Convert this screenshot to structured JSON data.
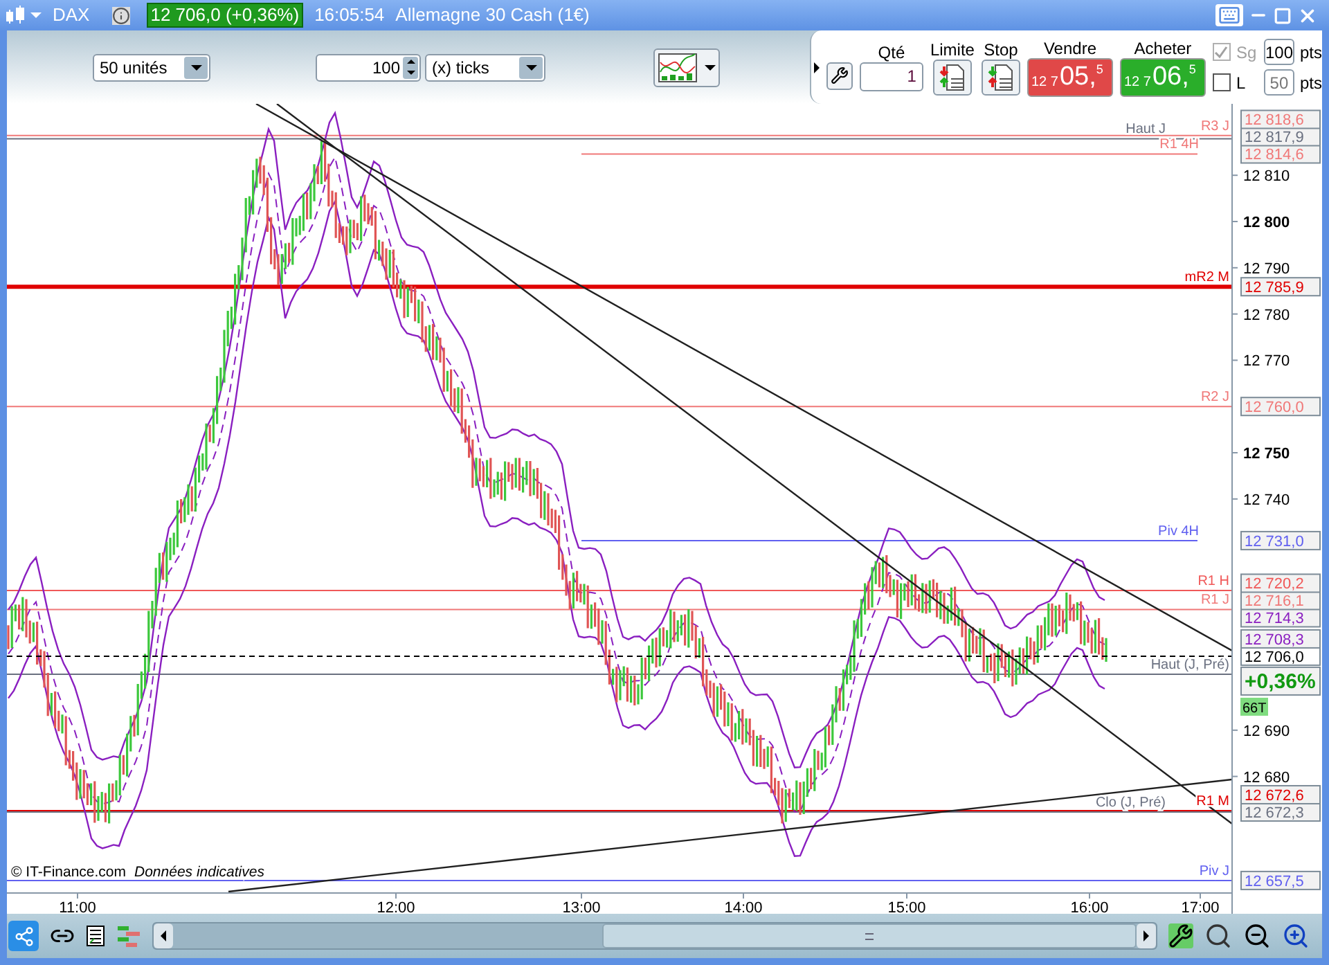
{
  "title_bar": {
    "symbol": "DAX",
    "quote": "12 706,0 (+0,36%)",
    "time": "16:05:54",
    "instrument": "Allemagne 30 Cash (1€)"
  },
  "toolbar": {
    "period": "50 unités",
    "tick_count": "100",
    "tick_unit": "(x) ticks"
  },
  "order_panel": {
    "qty_label": "Qté",
    "qty": "1",
    "limit_label": "Limite",
    "stop_label": "Stop",
    "sell": {
      "label": "Vendre",
      "prefix": "12 7",
      "main": "05,",
      "suffix": "5"
    },
    "buy": {
      "label": "Acheter",
      "prefix": "12 7",
      "main": "06,",
      "suffix": "5"
    },
    "sg": {
      "label": "Sg",
      "checked": true,
      "disabled": true,
      "value": "100",
      "unit": "pts"
    },
    "l": {
      "label": "L",
      "checked": false,
      "disabled": false,
      "value": "50",
      "unit": "pts"
    }
  },
  "chart": {
    "y_ticks": [
      {
        "label": "12 810",
        "major": false
      },
      {
        "label": "12 800",
        "major": true
      },
      {
        "label": "12 790",
        "major": false
      },
      {
        "label": "12 780",
        "major": false
      },
      {
        "label": "12 770",
        "major": false
      },
      {
        "label": "12 750",
        "major": true
      },
      {
        "label": "12 740",
        "major": false
      },
      {
        "label": "12 690",
        "major": false
      },
      {
        "label": "12 680",
        "major": false
      }
    ],
    "x_ticks": [
      "11:00",
      "12:00",
      "13:00",
      "14:00",
      "15:00",
      "16:00",
      "17:00"
    ],
    "levels": [
      {
        "label": "R3 J",
        "price": "12 818,6",
        "color": "#f07878",
        "kind": "line"
      },
      {
        "label": "Haut J",
        "price": "12 817,9",
        "color": "#6a7080",
        "kind": "line_left"
      },
      {
        "label": "R1 4H",
        "price": "12 814,6",
        "color": "#f07878",
        "kind": "short"
      },
      {
        "label": "mR2 M",
        "price": "12 785,9",
        "color": "#e00000",
        "kind": "thick"
      },
      {
        "label": "R2 J",
        "price": "12 760,0",
        "color": "#f07878",
        "kind": "line"
      },
      {
        "label": "Piv 4H",
        "price": "12 731,0",
        "color": "#6060f0",
        "kind": "short"
      },
      {
        "label": "R1 H",
        "price": "12 720,2",
        "color": "#f05858",
        "kind": "line"
      },
      {
        "label": "R1 J",
        "price": "12 716,1",
        "color": "#f07878",
        "kind": "line"
      },
      {
        "price": "12 714,3",
        "color": "#8a1fc0",
        "kind": "band"
      },
      {
        "price": "12 708,3",
        "color": "#8a1fc0",
        "kind": "band"
      },
      {
        "label": "Haut (J, Pré)",
        "color": "#6a7080",
        "kind": "under_change"
      },
      {
        "label": "R1 M",
        "price": "12 672,6",
        "color": "#e00000",
        "kind": "line"
      },
      {
        "label": "Clo (J, Pré)",
        "price": "12 672,3",
        "color": "#6a7080",
        "kind": "line_left"
      },
      {
        "label": "Piv J",
        "price": "12 657,5",
        "color": "#6060f0",
        "kind": "line"
      }
    ],
    "last_price": "12 706,0",
    "change": "+0,36%",
    "tick_badge": "66T",
    "copyright": "© IT-Finance.com",
    "disclaimer": "Données indicatives"
  }
}
